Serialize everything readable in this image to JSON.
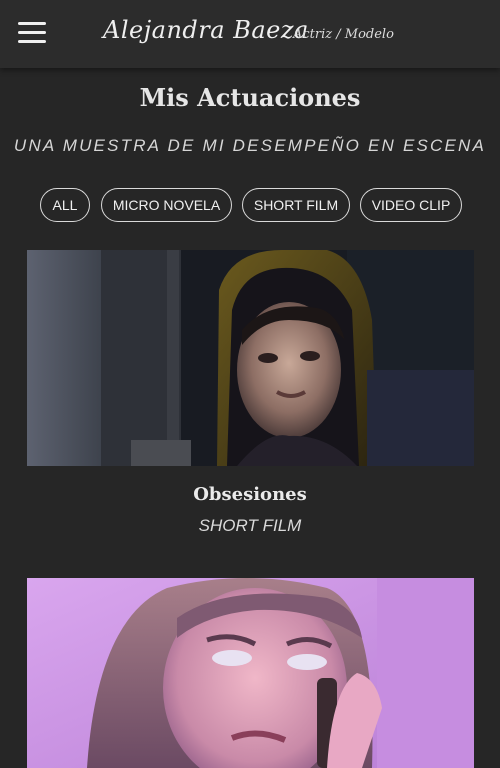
{
  "header": {
    "brand": "Alejandra Baeza",
    "tagline": "Actriz / Modelo",
    "menu_icon": "hamburger-menu-icon"
  },
  "main": {
    "title": "Mis Actuaciones",
    "subtitle": "UNA MUESTRA DE MI DESEMPEÑO EN ESCENA",
    "filters": [
      {
        "label": "ALL"
      },
      {
        "label": "MICRO NOVELA"
      },
      {
        "label": "SHORT FILM"
      },
      {
        "label": "VIDEO CLIP"
      }
    ],
    "works": [
      {
        "title": "Obsesiones",
        "category": "SHORT FILM"
      },
      {
        "title": "",
        "category": ""
      }
    ]
  },
  "colors": {
    "background": "#262626",
    "topbar": "#2c2c2c",
    "text": "#e8e8e8"
  }
}
